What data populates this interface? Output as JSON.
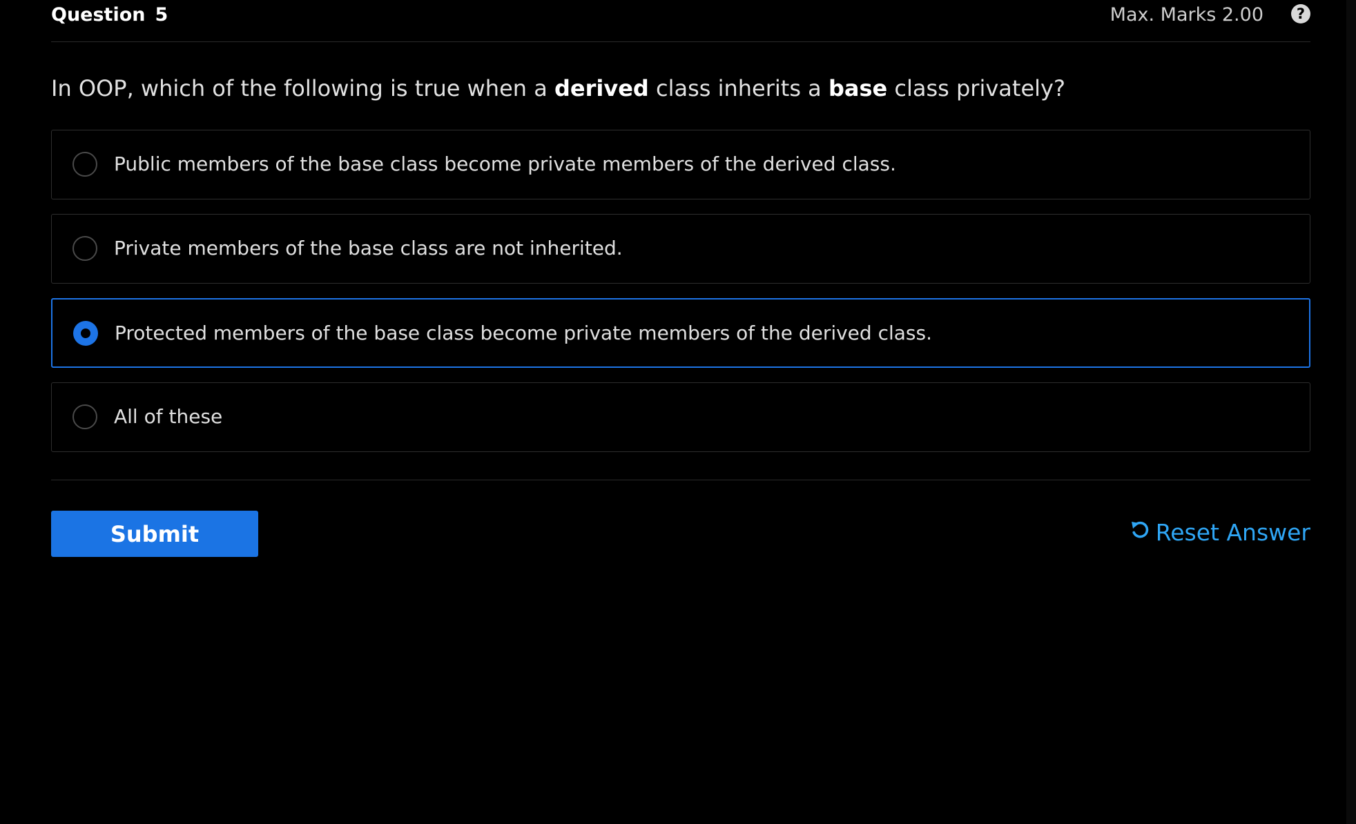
{
  "header": {
    "question_label": "Question",
    "question_number": "5",
    "max_marks": "Max. Marks 2.00",
    "help_icon": "question-circle-icon"
  },
  "question": {
    "part1": "In OOP, which of the following is true when a ",
    "bold1": "derived",
    "part2": " class inherits a ",
    "bold2": "base",
    "part3": " class privately?"
  },
  "options": [
    {
      "label": "Public members of the base class become private members of the derived class.",
      "selected": false
    },
    {
      "label": "Private members of the base class are not inherited.",
      "selected": false
    },
    {
      "label": "Protected members of the base class become private members of the derived class.",
      "selected": true
    },
    {
      "label": "All of these",
      "selected": false
    }
  ],
  "actions": {
    "submit_label": "Submit",
    "reset_label": "Reset Answer",
    "reset_icon": "undo-icon"
  },
  "colors": {
    "accent": "#1b74e4",
    "link": "#2fa6f5",
    "background": "#000000"
  }
}
